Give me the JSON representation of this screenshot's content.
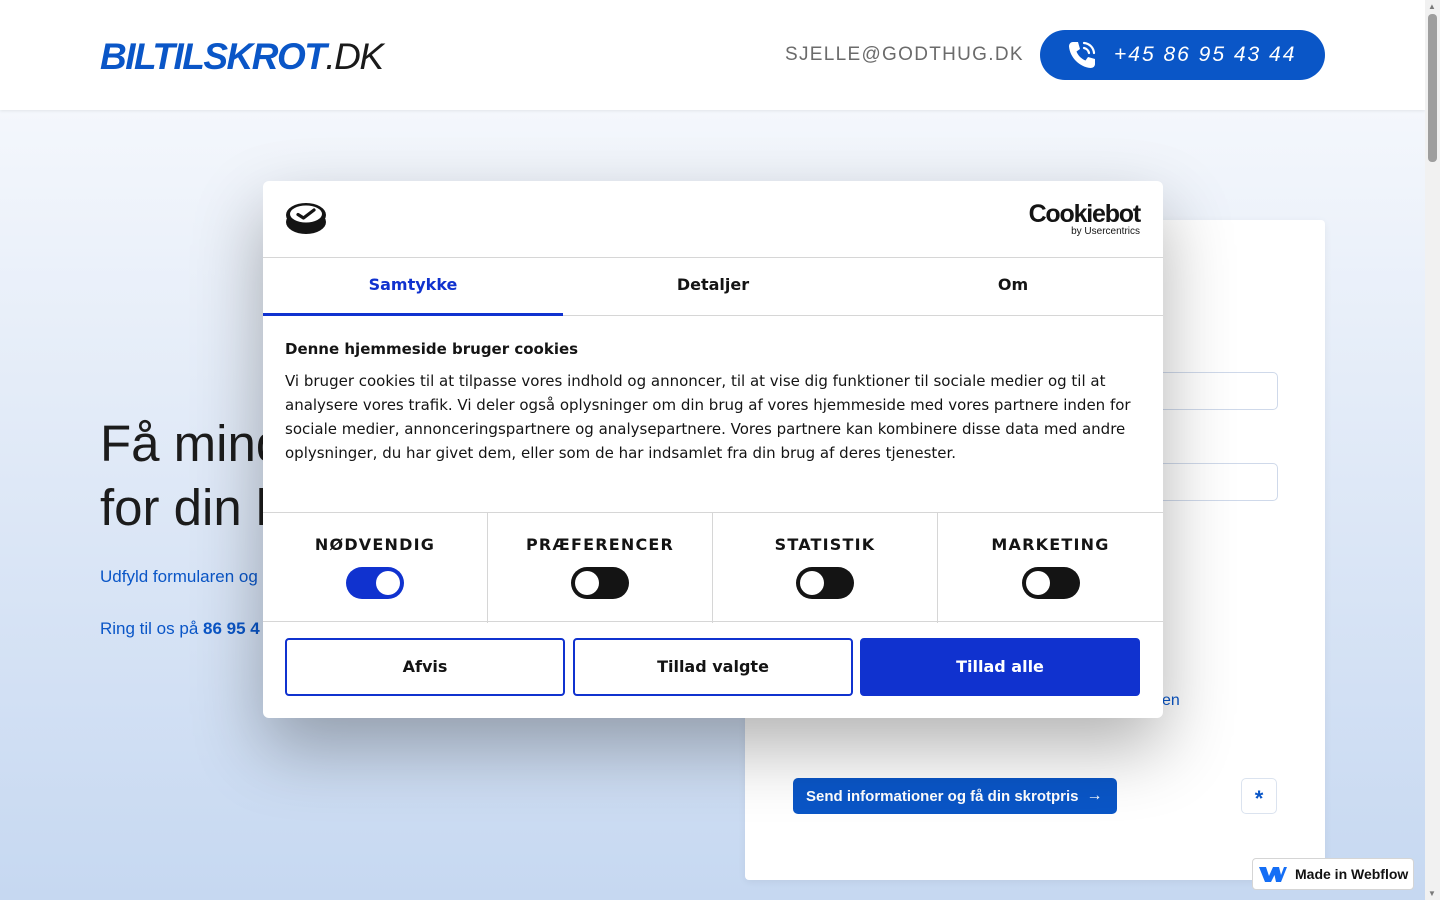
{
  "header": {
    "logo_brand": "BILTILSKROT",
    "logo_tld": ".DK",
    "email": "SJELLE@GODTHUG.DK",
    "phone": "+45 86 95 43 44"
  },
  "hero": {
    "title_line1": "Få mind",
    "title_line2": "for din k",
    "subtitle": "Udfyld formularen og",
    "ring_prefix": "Ring til os på ",
    "ring_number": "86 95 4"
  },
  "form": {
    "link_fragment": "en",
    "send_label": "Send informationer og få din skrotpris",
    "send_arrow": "→",
    "star": "*"
  },
  "cookie_dialog": {
    "logo_name": "Cookiebot",
    "logo_sub": "by Usercentrics",
    "tabs": [
      {
        "label": "Samtykke",
        "active": true
      },
      {
        "label": "Detaljer",
        "active": false
      },
      {
        "label": "Om",
        "active": false
      }
    ],
    "heading": "Denne hjemmeside bruger cookies",
    "body": "Vi bruger cookies til at tilpasse vores indhold og annoncer, til at vise dig funktioner til sociale medier og til at analysere vores trafik. Vi deler også oplysninger om din brug af vores hjemmeside med vores partnere inden for sociale medier, annonceringspartnere og analysepartnere. Vores partnere kan kombinere disse data med andre oplysninger, du har givet dem, eller som de har indsamlet fra din brug af deres tjenester.",
    "toggles": [
      {
        "label": "NØDVENDIG",
        "on": true
      },
      {
        "label": "PRÆFERENCER",
        "on": false
      },
      {
        "label": "STATISTIK",
        "on": false
      },
      {
        "label": "MARKETING",
        "on": false
      }
    ],
    "buttons": {
      "reject": "Afvis",
      "allow_selected": "Tillad valgte",
      "allow_all": "Tillad alle"
    }
  },
  "badge": {
    "label": "Made in Webflow"
  },
  "colors": {
    "brand_blue": "#0a56c7",
    "cookiebot_blue": "#1032cf"
  }
}
